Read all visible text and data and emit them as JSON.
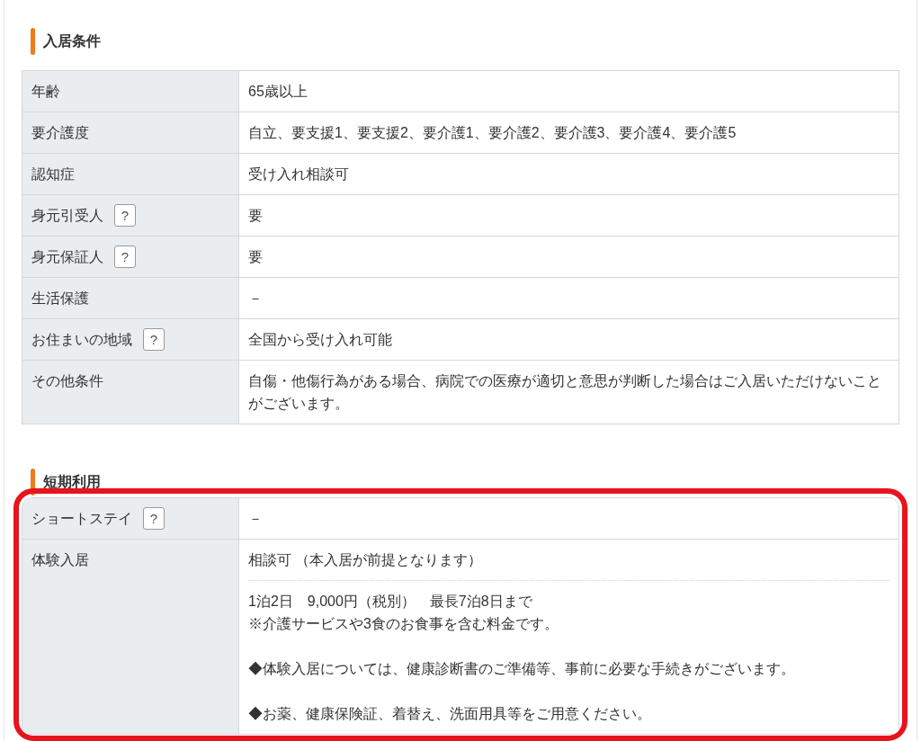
{
  "sections": [
    {
      "title": "入居条件",
      "highlighted": false,
      "rows": [
        {
          "label": "年齢",
          "blocks": [
            [
              [
                "65歳以上"
              ]
            ]
          ]
        },
        {
          "label": "要介護度",
          "blocks": [
            [
              [
                "自立、要支援1、要支援2、要介護1、要介護2、要介護3、要介護4、要介護5"
              ]
            ]
          ]
        },
        {
          "label": "認知症",
          "blocks": [
            [
              [
                "受け入れ相談可"
              ]
            ]
          ]
        },
        {
          "label": "身元引受人",
          "help": "?",
          "blocks": [
            [
              [
                "要"
              ]
            ]
          ]
        },
        {
          "label": "身元保証人",
          "help": "?",
          "blocks": [
            [
              [
                "要"
              ]
            ]
          ]
        },
        {
          "label": "生活保護",
          "blocks": [
            [
              [
                "－"
              ]
            ]
          ]
        },
        {
          "label": "お住まいの地域",
          "help": "?",
          "blocks": [
            [
              [
                "全国から受け入れ可能"
              ]
            ]
          ]
        },
        {
          "label": "その他条件",
          "blocks": [
            [
              [
                "自傷・他傷行為がある場合、病院での医療が適切と意思が判断した場合はご入居いただけないことがございます。"
              ]
            ]
          ]
        }
      ]
    },
    {
      "title": "短期利用",
      "highlighted": true,
      "rows": [
        {
          "label": "ショートステイ",
          "help": "?",
          "blocks": [
            [
              [
                "－"
              ]
            ]
          ]
        },
        {
          "label": "体験入居",
          "blocks": [
            [
              [
                "相談可 （本入居が前提となります）"
              ]
            ],
            [
              [
                "1泊2日　9,000円（税別）　最長7泊8日まで",
                "※介護サービスや3食のお食事を含む料金です。"
              ],
              [
                "◆体験入居については、健康診断書のご準備等、事前に必要な手続きがございます。"
              ],
              [
                "◆お薬、健康保険証、着替え、洗面用具等をご用意ください。"
              ]
            ]
          ]
        }
      ]
    }
  ]
}
